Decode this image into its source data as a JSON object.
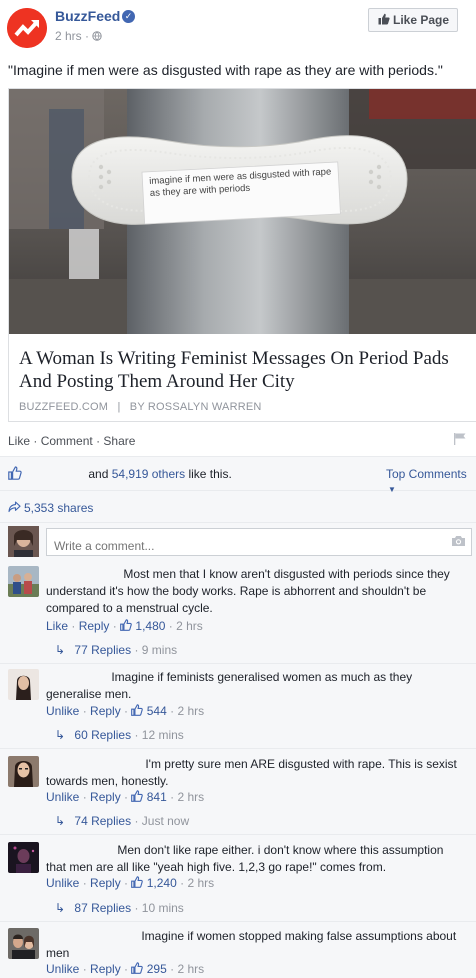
{
  "post": {
    "page_name": "BuzzFeed",
    "time": "2 hrs",
    "time_separator": "·",
    "like_page_label": "Like Page",
    "text": "\"Imagine if men were as disgusted with rape as they are with periods.\""
  },
  "link_card": {
    "image_note": "imagine if men were as disgusted with rape as they are with periods",
    "headline": "A Woman Is Writing Feminist Messages On Period Pads And Posting Them Around Her City",
    "source": "BUZZFEED.COM",
    "divider": "|",
    "byline": "BY ROSSALYN WARREN"
  },
  "actions": {
    "like": "Like",
    "comment": "Comment",
    "share": "Share",
    "dot": "·"
  },
  "feedback": {
    "likes_middle": "and",
    "likes_count": "54,919 others",
    "likes_suffix": "like this.",
    "top_comments": "Top Comments",
    "shares": "5,353 shares"
  },
  "composer": {
    "placeholder": "Write a comment..."
  },
  "comments": [
    {
      "text": "Most men that I know aren't disgusted with periods since they understand it's how the body works. Rape is abhorrent and shouldn't be compared to a menstrual cycle.",
      "like_label": "Like",
      "reply_label": "Reply",
      "likes": "1,480",
      "time": "2 hrs",
      "replies": "77 Replies",
      "replies_time": "9 mins"
    },
    {
      "text": "Imagine if feminists generalised women as much as they generalise men.",
      "like_label": "Unlike",
      "reply_label": "Reply",
      "likes": "544",
      "time": "2 hrs",
      "replies": "60 Replies",
      "replies_time": "12 mins"
    },
    {
      "text": "I'm pretty sure men ARE disgusted with rape. This is sexist towards men, honestly.",
      "like_label": "Unlike",
      "reply_label": "Reply",
      "likes": "841",
      "time": "2 hrs",
      "replies": "74 Replies",
      "replies_time": "Just now"
    },
    {
      "text": "Men don't like rape either. i don't know where this assumption that men are all like \"yeah high five. 1,2,3 go rape!\" comes from.",
      "like_label": "Unlike",
      "reply_label": "Reply",
      "likes": "1,240",
      "time": "2 hrs",
      "replies": "87 Replies",
      "replies_time": "10 mins"
    },
    {
      "text": "Imagine if women stopped making false assumptions about men",
      "like_label": "Unlike",
      "reply_label": "Reply",
      "likes": "295",
      "time": "2 hrs"
    }
  ],
  "colors": {
    "link_blue": "#365899",
    "meta_gray": "#90949c",
    "brand_red": "#ee3322",
    "feedback_bg": "#f6f7f9"
  },
  "icons": {
    "logo": "buzzfeed-trending-arrow",
    "verified": "verified-check-icon",
    "globe": "globe-icon",
    "thumb": "thumbs-up-icon",
    "flag": "flag-icon",
    "share": "share-arrow-icon",
    "camera": "camera-icon",
    "reply_arrow": "reply-arrow-icon"
  }
}
